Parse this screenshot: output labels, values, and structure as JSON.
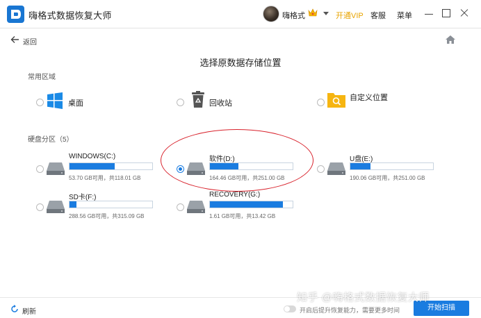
{
  "app": {
    "title": "嗨格式数据恢复大师",
    "username": "嗨格式",
    "vip_label": "开通VIP",
    "service_label": "客服",
    "menu_label": "菜单"
  },
  "nav": {
    "back_label": "返回"
  },
  "page": {
    "title": "选择原数据存储位置"
  },
  "common": {
    "label": "常用区域",
    "items": [
      {
        "label": "桌面",
        "icon": "windows-icon"
      },
      {
        "label": "回收站",
        "icon": "recycle-bin-icon"
      },
      {
        "label": "自定义位置",
        "icon": "custom-folder-icon"
      }
    ]
  },
  "disks": {
    "label": "硬盘分区（5）",
    "drives": [
      {
        "name": "WINDOWS(C:)",
        "info": "53.70 GB可用，共118.01 GB",
        "used_fraction": 0.545,
        "selected": false
      },
      {
        "name": "软件(D:)",
        "info": "164.46 GB可用，共251.00 GB",
        "used_fraction": 0.345,
        "selected": true
      },
      {
        "name": "U盘(E:)",
        "info": "190.06 GB可用，共251.00 GB",
        "used_fraction": 0.243,
        "selected": false
      },
      {
        "name": "SD卡(F:)",
        "info": "288.56 GB可用，共315.09 GB",
        "used_fraction": 0.084,
        "selected": false
      },
      {
        "name": "RECOVERY(G:)",
        "info": "1.61 GB可用，共13.42 GB",
        "used_fraction": 0.88,
        "selected": false
      }
    ]
  },
  "footer": {
    "refresh_label": "刷新",
    "toggle_text": "开启后提升恢复能力，需要更多时间",
    "scan_label": "开始扫描"
  },
  "watermark": "知乎 @嗨格式数据恢复大师",
  "colors": {
    "accent": "#1a7ce0",
    "vip": "#e8a400",
    "annotation": "#d8202a"
  }
}
